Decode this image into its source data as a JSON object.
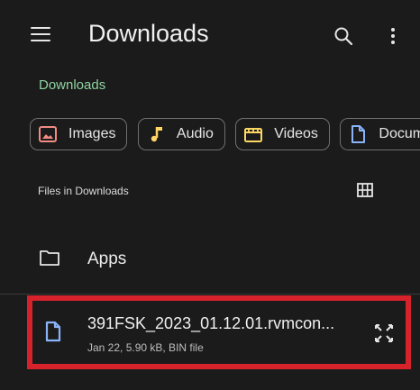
{
  "header": {
    "title": "Downloads",
    "menu_icon": "menu-icon",
    "search_icon": "search-icon",
    "more_icon": "more-vert-icon"
  },
  "breadcrumb": {
    "label": "Downloads"
  },
  "filters": [
    {
      "label": "Images",
      "icon": "image-icon",
      "color": "#f28b82"
    },
    {
      "label": "Audio",
      "icon": "music-note-icon",
      "color": "#fdd663"
    },
    {
      "label": "Videos",
      "icon": "clapperboard-icon",
      "color": "#fdd663"
    },
    {
      "label": "Documents",
      "icon": "document-icon",
      "color": "#8ab4f8"
    }
  ],
  "section": {
    "label": "Files in Downloads",
    "view_toggle_icon": "grid-view-icon"
  },
  "folders": [
    {
      "name": "Apps",
      "icon": "folder-icon"
    }
  ],
  "files": [
    {
      "name": "391FSK_2023_01.12.01.rvmcon...",
      "meta": "Jan 22, 5.90 kB, BIN file",
      "icon": "file-icon",
      "action_icon": "expand-icon",
      "highlight_color": "#d5222b"
    }
  ],
  "colors": {
    "background": "#1b1b1b",
    "breadcrumb": "#8fd3a0",
    "file_icon": "#8ab4f8"
  }
}
